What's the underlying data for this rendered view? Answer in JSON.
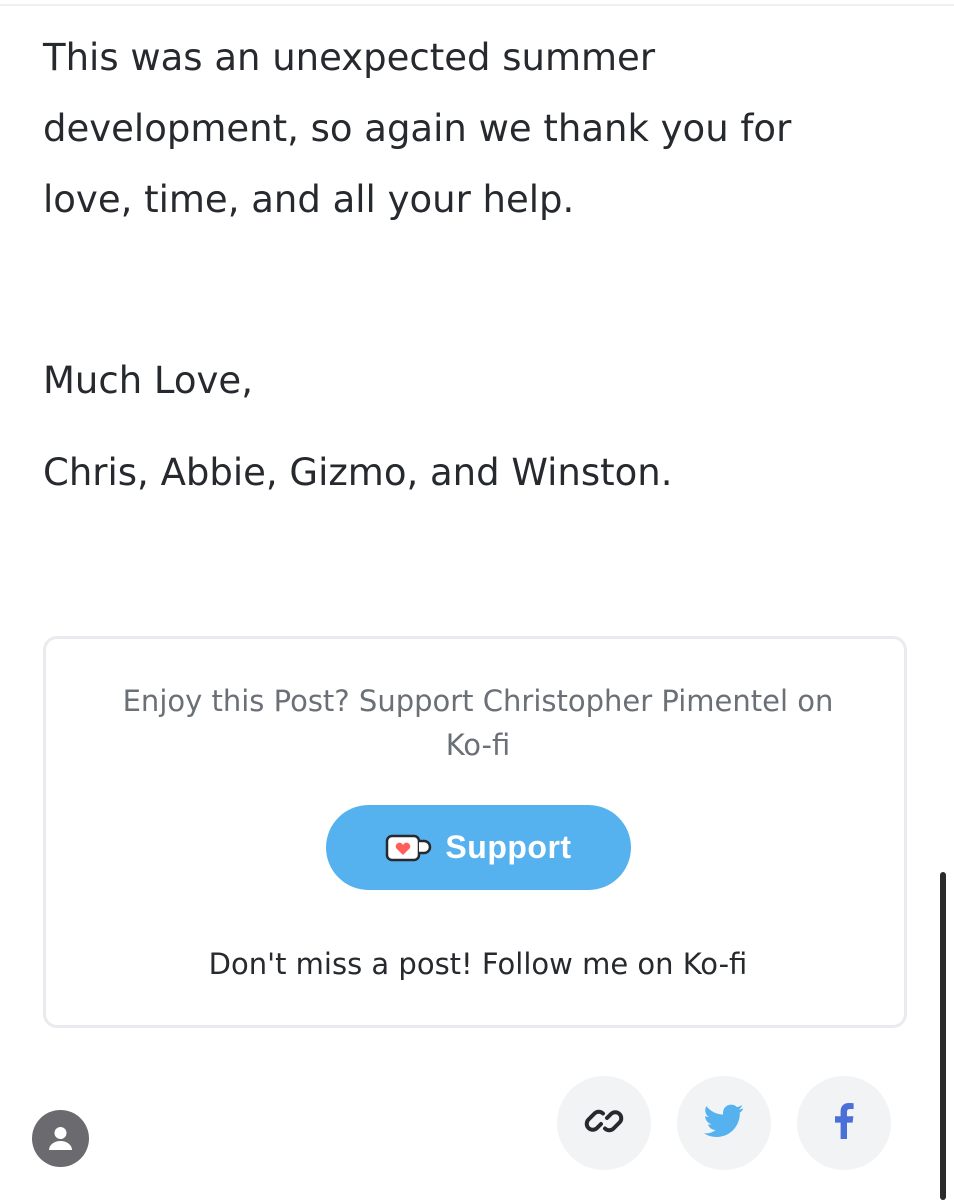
{
  "post": {
    "paragraph_lines": [
      "This was an unexpected summer",
      "development, so again we thank you for",
      "love, time, and all your help."
    ],
    "sign_off": "Much Love,",
    "signature": "Chris, Abbie, Gizmo, and Winston."
  },
  "kofi_card": {
    "prompt_line_1": "Enjoy this Post? Support Christopher Pimentel on",
    "prompt_line_2": "Ko-fi",
    "support_button_label": "Support",
    "support_button_icon": "kofi-cup-icon",
    "follow_link": "Don't miss a post! Follow me on Ko-fi",
    "accent_color": "#55b2ee"
  },
  "footer": {
    "avatar_icon": "user-avatar-icon",
    "share_buttons": [
      {
        "icon": "link-icon",
        "color": "#26292e"
      },
      {
        "icon": "twitter-icon",
        "color": "#55b2ee"
      },
      {
        "icon": "facebook-icon",
        "color": "#4a6fd8"
      }
    ]
  }
}
